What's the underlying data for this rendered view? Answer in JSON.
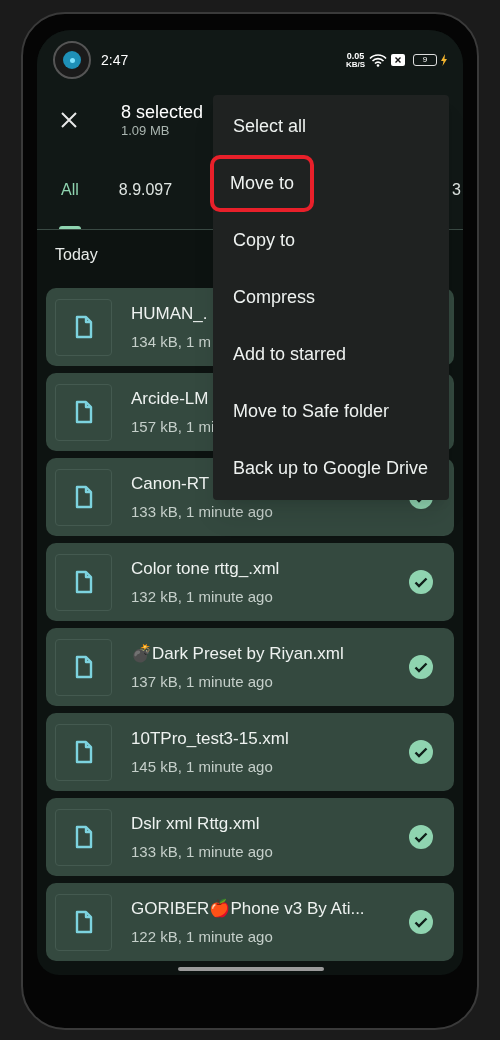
{
  "status_bar": {
    "time": "2:47",
    "speed": "0.05",
    "speed_unit": "KB/S",
    "battery": "9"
  },
  "header": {
    "title": "8 selected",
    "subtitle": "1.09 MB"
  },
  "tabs": [
    {
      "label": "All",
      "selected": true
    },
    {
      "label": "8.9.097",
      "selected": false
    },
    {
      "label": "3",
      "selected": false
    }
  ],
  "section": "Today",
  "files": [
    {
      "name": "HUMAN_.",
      "meta": "134 kB, 1 m"
    },
    {
      "name": "Arcide-LM",
      "meta": "157 kB, 1 mi"
    },
    {
      "name": "Canon-RT",
      "meta": "133 kB, 1 minute ago",
      "selected": true
    },
    {
      "name": "Color tone rttg_.xml",
      "meta": "132 kB, 1 minute ago",
      "selected": true
    },
    {
      "name": "💣Dark Preset by Riyan.xml",
      "meta": "137 kB, 1 minute ago",
      "selected": true
    },
    {
      "name": "10TPro_test3-15.xml",
      "meta": "145 kB, 1 minute ago",
      "selected": true
    },
    {
      "name": "Dslr xml Rttg.xml",
      "meta": "133 kB, 1 minute ago",
      "selected": true
    },
    {
      "name": "GORIBER🍎Phone v3 By Ati...",
      "meta": "122 kB, 1 minute ago",
      "selected": true
    }
  ],
  "menu": [
    {
      "label": "Select all",
      "highlighted": false
    },
    {
      "label": "Move to",
      "highlighted": true
    },
    {
      "label": "Copy to",
      "highlighted": false
    },
    {
      "label": "Compress",
      "highlighted": false
    },
    {
      "label": "Add to starred",
      "highlighted": false
    },
    {
      "label": "Move to Safe folder",
      "highlighted": false
    },
    {
      "label": "Back up to Google Drive",
      "highlighted": false
    }
  ]
}
